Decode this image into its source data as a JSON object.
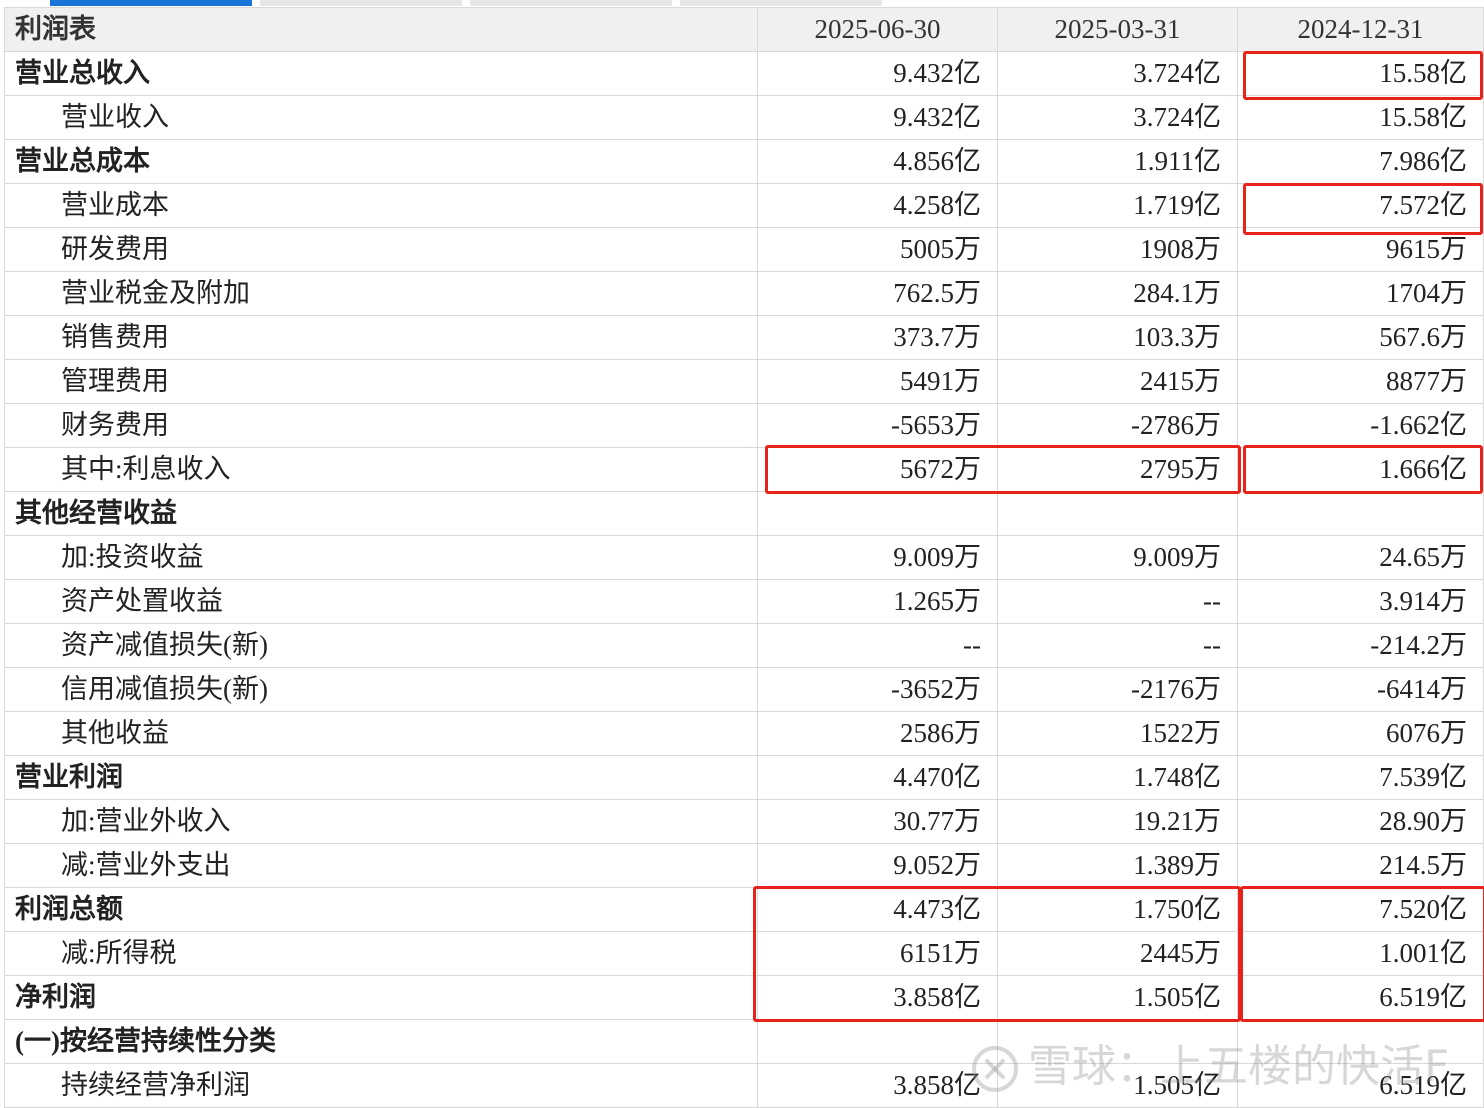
{
  "table": {
    "title": "利润表",
    "periods": [
      "2025-06-30",
      "2025-03-31",
      "2024-12-31"
    ],
    "rows": [
      {
        "label": "营业总收入",
        "values": [
          "9.432亿",
          "3.724亿",
          "15.58亿"
        ]
      },
      {
        "label": "营业收入",
        "values": [
          "9.432亿",
          "3.724亿",
          "15.58亿"
        ]
      },
      {
        "label": "营业总成本",
        "values": [
          "4.856亿",
          "1.911亿",
          "7.986亿"
        ]
      },
      {
        "label": "营业成本",
        "values": [
          "4.258亿",
          "1.719亿",
          "7.572亿"
        ]
      },
      {
        "label": "研发费用",
        "values": [
          "5005万",
          "1908万",
          "9615万"
        ]
      },
      {
        "label": "营业税金及附加",
        "values": [
          "762.5万",
          "284.1万",
          "1704万"
        ]
      },
      {
        "label": "销售费用",
        "values": [
          "373.7万",
          "103.3万",
          "567.6万"
        ]
      },
      {
        "label": "管理费用",
        "values": [
          "5491万",
          "2415万",
          "8877万"
        ]
      },
      {
        "label": "财务费用",
        "values": [
          "-5653万",
          "-2786万",
          "-1.662亿"
        ]
      },
      {
        "label": "其中:利息收入",
        "values": [
          "5672万",
          "2795万",
          "1.666亿"
        ]
      },
      {
        "label": "其他经营收益",
        "values": [
          "",
          "",
          ""
        ]
      },
      {
        "label": "加:投资收益",
        "values": [
          "9.009万",
          "9.009万",
          "24.65万"
        ]
      },
      {
        "label": "资产处置收益",
        "values": [
          "1.265万",
          "--",
          "3.914万"
        ]
      },
      {
        "label": "资产减值损失(新)",
        "values": [
          "--",
          "--",
          "-214.2万"
        ]
      },
      {
        "label": "信用减值损失(新)",
        "values": [
          "-3652万",
          "-2176万",
          "-6414万"
        ]
      },
      {
        "label": "其他收益",
        "values": [
          "2586万",
          "1522万",
          "6076万"
        ]
      },
      {
        "label": "营业利润",
        "values": [
          "4.470亿",
          "1.748亿",
          "7.539亿"
        ]
      },
      {
        "label": "加:营业外收入",
        "values": [
          "30.77万",
          "19.21万",
          "28.90万"
        ]
      },
      {
        "label": "减:营业外支出",
        "values": [
          "9.052万",
          "1.389万",
          "214.5万"
        ]
      },
      {
        "label": "利润总额",
        "values": [
          "4.473亿",
          "1.750亿",
          "7.520亿"
        ]
      },
      {
        "label": "减:所得税",
        "values": [
          "6151万",
          "2445万",
          "1.001亿"
        ]
      },
      {
        "label": "净利润",
        "values": [
          "3.858亿",
          "1.505亿",
          "6.519亿"
        ]
      },
      {
        "label": "(一)按经营持续性分类",
        "values": [
          "",
          "",
          ""
        ]
      },
      {
        "label": "持续经营净利润",
        "values": [
          "3.858亿",
          "1.505亿",
          "6.519亿"
        ]
      }
    ]
  },
  "watermark": {
    "text": "雪球：上五楼的快活F"
  },
  "colors": {
    "highlight": "#e8231c",
    "header_bg": "#f0f0f0",
    "tab_active": "#1a73d9"
  }
}
